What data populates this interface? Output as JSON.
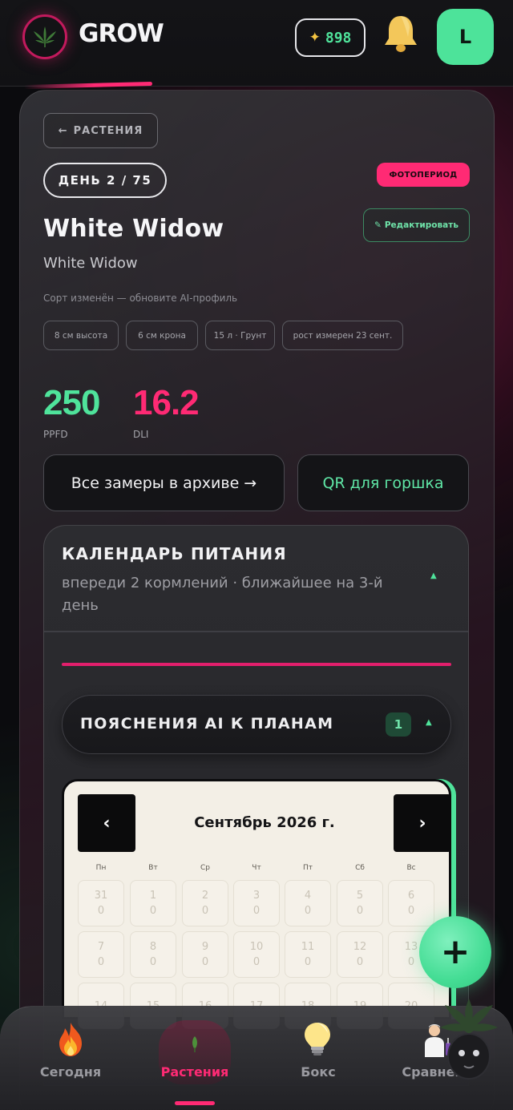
{
  "header": {
    "logo_text": "GROW",
    "coins_icon": "sparkle-icon",
    "coins": "898",
    "bell_icon": "bell-icon",
    "avatar_initial": "L"
  },
  "plant": {
    "back_label": "РАСТЕНИЯ",
    "back_icon": "arrow-left-icon",
    "day_label": "ДЕНЬ 2 / 75",
    "phase_badge": "ФОТОПЕРИОД",
    "title": "White Widow",
    "edit_label": "Редактировать",
    "edit_icon": "pencil-icon",
    "strain": "White Widow",
    "hint": "Сорт изменён — обновите AI-профиль",
    "chips": [
      "8 см высота",
      "6 см крона",
      "15 л · Грунт",
      "рост измерен 23 сент."
    ]
  },
  "metrics": {
    "ppfd_value": "250",
    "ppfd_label": "PPFD",
    "dli_value": "16.2",
    "dli_label": "DLI",
    "ppfd_color": "#4fe39b",
    "dli_color": "#ff2a74"
  },
  "actions": {
    "archive_label": "Все замеры в архиве →",
    "qr_label": "QR для горшка"
  },
  "feeding": {
    "title": "КАЛЕНДАРЬ ПИТАНИЯ",
    "subtitle": "впереди 2 кормлений · ближайшее на 3-й день",
    "ai_title": "ПОЯСНЕНИЯ AI К ПЛАНАМ",
    "ai_count": "1"
  },
  "calendar": {
    "month": "Сентябрь 2026 г.",
    "prev": "‹",
    "next": "›",
    "weekdays": [
      "Пн",
      "Вт",
      "Ср",
      "Чт",
      "Пт",
      "Сб",
      "Вс"
    ],
    "days": [
      {
        "d": "31",
        "v": "0"
      },
      {
        "d": "1",
        "v": "0"
      },
      {
        "d": "2",
        "v": "0"
      },
      {
        "d": "3",
        "v": "0"
      },
      {
        "d": "4",
        "v": "0"
      },
      {
        "d": "5",
        "v": "0"
      },
      {
        "d": "6",
        "v": "0"
      },
      {
        "d": "7",
        "v": "0"
      },
      {
        "d": "8",
        "v": "0"
      },
      {
        "d": "9",
        "v": "0"
      },
      {
        "d": "10",
        "v": "0"
      },
      {
        "d": "11",
        "v": "0"
      },
      {
        "d": "12",
        "v": "0"
      },
      {
        "d": "13",
        "v": "0"
      },
      {
        "d": "14",
        "v": ""
      },
      {
        "d": "15",
        "v": ""
      },
      {
        "d": "16",
        "v": ""
      },
      {
        "d": "17",
        "v": ""
      },
      {
        "d": "18",
        "v": ""
      },
      {
        "d": "19",
        "v": ""
      },
      {
        "d": "20",
        "v": ""
      }
    ]
  },
  "fab": {
    "label": "+"
  },
  "nav": [
    {
      "label": "Сегодня",
      "icon": "fire-icon",
      "active": false
    },
    {
      "label": "Растения",
      "icon": "sprout-icon",
      "active": true
    },
    {
      "label": "Бокс",
      "icon": "lightbulb-icon",
      "active": false
    },
    {
      "label": "Сравнение",
      "icon": "scientist-icon",
      "active": false
    }
  ],
  "accent_colors": {
    "pink": "#ff2a74",
    "green": "#4fe39b"
  }
}
